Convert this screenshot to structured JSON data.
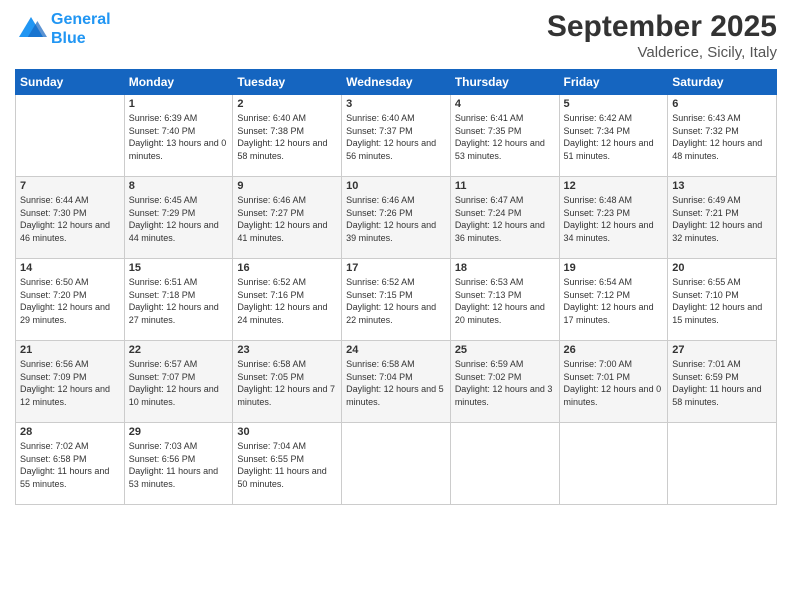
{
  "logo": {
    "line1": "General",
    "line2": "Blue"
  },
  "title": "September 2025",
  "location": "Valderice, Sicily, Italy",
  "days_of_week": [
    "Sunday",
    "Monday",
    "Tuesday",
    "Wednesday",
    "Thursday",
    "Friday",
    "Saturday"
  ],
  "weeks": [
    [
      {
        "day": "",
        "sunrise": "",
        "sunset": "",
        "daylight": "",
        "empty": true
      },
      {
        "day": "1",
        "sunrise": "Sunrise: 6:39 AM",
        "sunset": "Sunset: 7:40 PM",
        "daylight": "Daylight: 13 hours and 0 minutes.",
        "empty": false
      },
      {
        "day": "2",
        "sunrise": "Sunrise: 6:40 AM",
        "sunset": "Sunset: 7:38 PM",
        "daylight": "Daylight: 12 hours and 58 minutes.",
        "empty": false
      },
      {
        "day": "3",
        "sunrise": "Sunrise: 6:40 AM",
        "sunset": "Sunset: 7:37 PM",
        "daylight": "Daylight: 12 hours and 56 minutes.",
        "empty": false
      },
      {
        "day": "4",
        "sunrise": "Sunrise: 6:41 AM",
        "sunset": "Sunset: 7:35 PM",
        "daylight": "Daylight: 12 hours and 53 minutes.",
        "empty": false
      },
      {
        "day": "5",
        "sunrise": "Sunrise: 6:42 AM",
        "sunset": "Sunset: 7:34 PM",
        "daylight": "Daylight: 12 hours and 51 minutes.",
        "empty": false
      },
      {
        "day": "6",
        "sunrise": "Sunrise: 6:43 AM",
        "sunset": "Sunset: 7:32 PM",
        "daylight": "Daylight: 12 hours and 48 minutes.",
        "empty": false
      }
    ],
    [
      {
        "day": "7",
        "sunrise": "Sunrise: 6:44 AM",
        "sunset": "Sunset: 7:30 PM",
        "daylight": "Daylight: 12 hours and 46 minutes.",
        "empty": false
      },
      {
        "day": "8",
        "sunrise": "Sunrise: 6:45 AM",
        "sunset": "Sunset: 7:29 PM",
        "daylight": "Daylight: 12 hours and 44 minutes.",
        "empty": false
      },
      {
        "day": "9",
        "sunrise": "Sunrise: 6:46 AM",
        "sunset": "Sunset: 7:27 PM",
        "daylight": "Daylight: 12 hours and 41 minutes.",
        "empty": false
      },
      {
        "day": "10",
        "sunrise": "Sunrise: 6:46 AM",
        "sunset": "Sunset: 7:26 PM",
        "daylight": "Daylight: 12 hours and 39 minutes.",
        "empty": false
      },
      {
        "day": "11",
        "sunrise": "Sunrise: 6:47 AM",
        "sunset": "Sunset: 7:24 PM",
        "daylight": "Daylight: 12 hours and 36 minutes.",
        "empty": false
      },
      {
        "day": "12",
        "sunrise": "Sunrise: 6:48 AM",
        "sunset": "Sunset: 7:23 PM",
        "daylight": "Daylight: 12 hours and 34 minutes.",
        "empty": false
      },
      {
        "day": "13",
        "sunrise": "Sunrise: 6:49 AM",
        "sunset": "Sunset: 7:21 PM",
        "daylight": "Daylight: 12 hours and 32 minutes.",
        "empty": false
      }
    ],
    [
      {
        "day": "14",
        "sunrise": "Sunrise: 6:50 AM",
        "sunset": "Sunset: 7:20 PM",
        "daylight": "Daylight: 12 hours and 29 minutes.",
        "empty": false
      },
      {
        "day": "15",
        "sunrise": "Sunrise: 6:51 AM",
        "sunset": "Sunset: 7:18 PM",
        "daylight": "Daylight: 12 hours and 27 minutes.",
        "empty": false
      },
      {
        "day": "16",
        "sunrise": "Sunrise: 6:52 AM",
        "sunset": "Sunset: 7:16 PM",
        "daylight": "Daylight: 12 hours and 24 minutes.",
        "empty": false
      },
      {
        "day": "17",
        "sunrise": "Sunrise: 6:52 AM",
        "sunset": "Sunset: 7:15 PM",
        "daylight": "Daylight: 12 hours and 22 minutes.",
        "empty": false
      },
      {
        "day": "18",
        "sunrise": "Sunrise: 6:53 AM",
        "sunset": "Sunset: 7:13 PM",
        "daylight": "Daylight: 12 hours and 20 minutes.",
        "empty": false
      },
      {
        "day": "19",
        "sunrise": "Sunrise: 6:54 AM",
        "sunset": "Sunset: 7:12 PM",
        "daylight": "Daylight: 12 hours and 17 minutes.",
        "empty": false
      },
      {
        "day": "20",
        "sunrise": "Sunrise: 6:55 AM",
        "sunset": "Sunset: 7:10 PM",
        "daylight": "Daylight: 12 hours and 15 minutes.",
        "empty": false
      }
    ],
    [
      {
        "day": "21",
        "sunrise": "Sunrise: 6:56 AM",
        "sunset": "Sunset: 7:09 PM",
        "daylight": "Daylight: 12 hours and 12 minutes.",
        "empty": false
      },
      {
        "day": "22",
        "sunrise": "Sunrise: 6:57 AM",
        "sunset": "Sunset: 7:07 PM",
        "daylight": "Daylight: 12 hours and 10 minutes.",
        "empty": false
      },
      {
        "day": "23",
        "sunrise": "Sunrise: 6:58 AM",
        "sunset": "Sunset: 7:05 PM",
        "daylight": "Daylight: 12 hours and 7 minutes.",
        "empty": false
      },
      {
        "day": "24",
        "sunrise": "Sunrise: 6:58 AM",
        "sunset": "Sunset: 7:04 PM",
        "daylight": "Daylight: 12 hours and 5 minutes.",
        "empty": false
      },
      {
        "day": "25",
        "sunrise": "Sunrise: 6:59 AM",
        "sunset": "Sunset: 7:02 PM",
        "daylight": "Daylight: 12 hours and 3 minutes.",
        "empty": false
      },
      {
        "day": "26",
        "sunrise": "Sunrise: 7:00 AM",
        "sunset": "Sunset: 7:01 PM",
        "daylight": "Daylight: 12 hours and 0 minutes.",
        "empty": false
      },
      {
        "day": "27",
        "sunrise": "Sunrise: 7:01 AM",
        "sunset": "Sunset: 6:59 PM",
        "daylight": "Daylight: 11 hours and 58 minutes.",
        "empty": false
      }
    ],
    [
      {
        "day": "28",
        "sunrise": "Sunrise: 7:02 AM",
        "sunset": "Sunset: 6:58 PM",
        "daylight": "Daylight: 11 hours and 55 minutes.",
        "empty": false
      },
      {
        "day": "29",
        "sunrise": "Sunrise: 7:03 AM",
        "sunset": "Sunset: 6:56 PM",
        "daylight": "Daylight: 11 hours and 53 minutes.",
        "empty": false
      },
      {
        "day": "30",
        "sunrise": "Sunrise: 7:04 AM",
        "sunset": "Sunset: 6:55 PM",
        "daylight": "Daylight: 11 hours and 50 minutes.",
        "empty": false
      },
      {
        "day": "",
        "sunrise": "",
        "sunset": "",
        "daylight": "",
        "empty": true
      },
      {
        "day": "",
        "sunrise": "",
        "sunset": "",
        "daylight": "",
        "empty": true
      },
      {
        "day": "",
        "sunrise": "",
        "sunset": "",
        "daylight": "",
        "empty": true
      },
      {
        "day": "",
        "sunrise": "",
        "sunset": "",
        "daylight": "",
        "empty": true
      }
    ]
  ]
}
